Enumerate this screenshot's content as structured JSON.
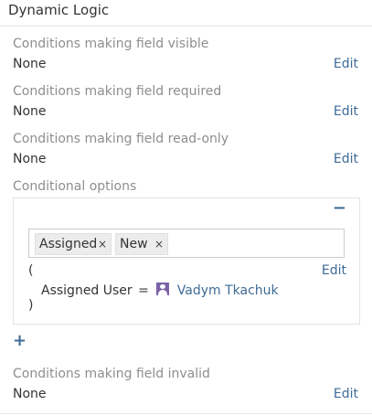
{
  "section_title": "Dynamic Logic",
  "visible": {
    "label": "Conditions making field visible",
    "value": "None",
    "edit": "Edit"
  },
  "required": {
    "label": "Conditions making field required",
    "value": "None",
    "edit": "Edit"
  },
  "readonly": {
    "label": "Conditions making field read-only",
    "value": "None",
    "edit": "Edit"
  },
  "options": {
    "label": "Conditional options",
    "remove_icon": "minus-icon",
    "tags": [
      {
        "label": "Assigned",
        "remove": "×"
      },
      {
        "label": "New",
        "remove": "×"
      }
    ],
    "open_paren": "(",
    "close_paren": ")",
    "edit": "Edit",
    "condition": {
      "field": "Assigned User",
      "operator": "=",
      "user_icon": "user-icon",
      "user": "Vadym Tkachuk"
    },
    "add_icon": "plus-icon"
  },
  "invalid": {
    "label": "Conditions making field invalid",
    "value": "None",
    "edit": "Edit"
  },
  "colors": {
    "link": "#3f6b96",
    "label": "#8e8e8e",
    "text": "#333333",
    "user_icon": "#7b62a8"
  }
}
